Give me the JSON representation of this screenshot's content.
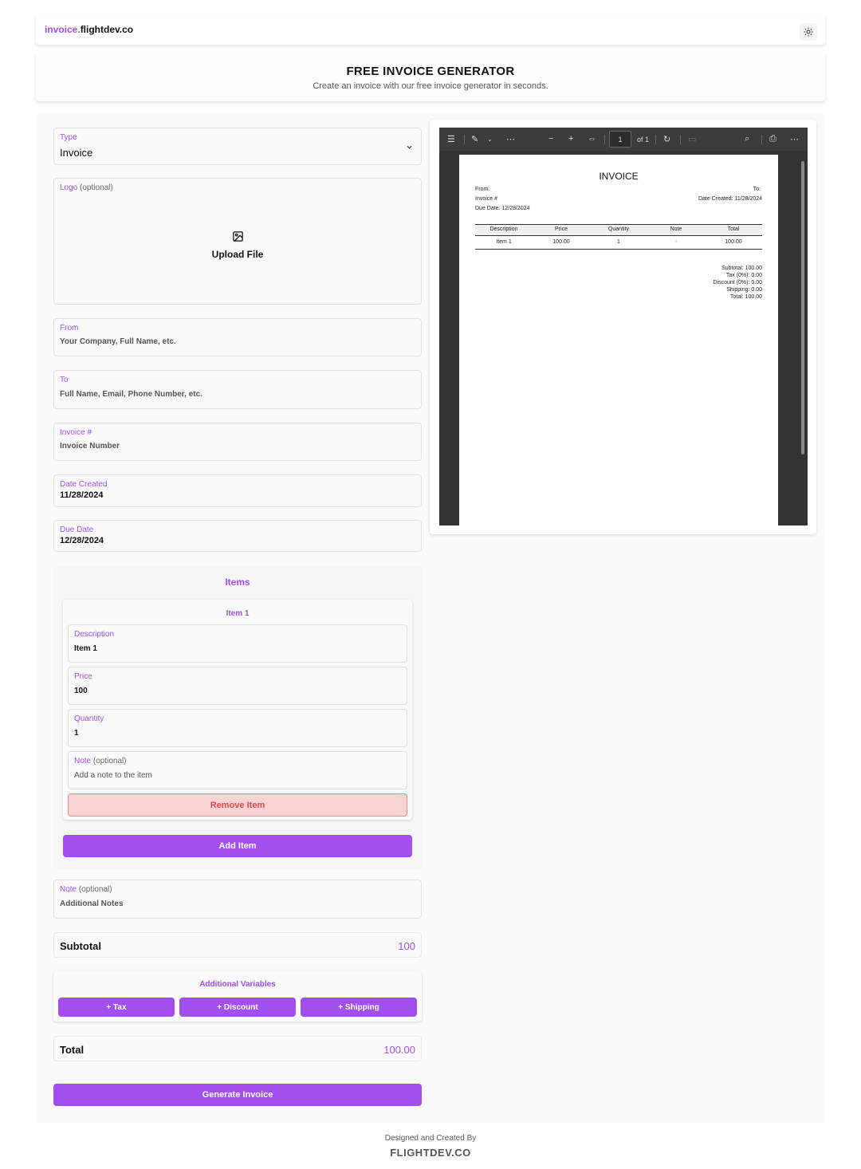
{
  "brand": {
    "part1": "invoice.",
    "part2": "flightdev.co"
  },
  "theme_toggle_icon": "sun-icon",
  "hero": {
    "title": "FREE INVOICE GENERATOR",
    "subtitle": "Create an invoice with our free invoice generator in seconds."
  },
  "form": {
    "type": {
      "label": "Type",
      "value": "Invoice"
    },
    "logo": {
      "label": "Logo",
      "optional": "(optional)",
      "upload": "Upload File"
    },
    "from": {
      "label": "From",
      "placeholder": "Your Company, Full Name, etc."
    },
    "to": {
      "label": "To",
      "placeholder": "Full Name, Email, Phone Number, etc."
    },
    "invoice_number": {
      "label": "Invoice #",
      "placeholder": "Invoice Number"
    },
    "date_created": {
      "label": "Date Created",
      "value": "11/28/2024"
    },
    "due_date": {
      "label": "Due Date",
      "value": "12/28/2024"
    }
  },
  "items": {
    "title": "Items",
    "list": [
      {
        "title": "Item 1",
        "description": {
          "label": "Description",
          "value": "Item 1"
        },
        "price": {
          "label": "Price",
          "value": "100"
        },
        "quantity": {
          "label": "Quantity",
          "value": "1"
        },
        "note": {
          "label": "Note",
          "optional": "(optional)",
          "placeholder": "Add a note to the item"
        },
        "remove_label": "Remove Item"
      }
    ],
    "add_label": "Add Item"
  },
  "note": {
    "label": "Note",
    "optional": "(optional)",
    "placeholder": "Additional Notes"
  },
  "subtotal": {
    "label": "Subtotal",
    "value": "100"
  },
  "additional": {
    "title": "Additional Variables",
    "tax": "+ Tax",
    "discount": "+ Discount",
    "shipping": "+ Shipping"
  },
  "total": {
    "label": "Total",
    "value": "100.00"
  },
  "generate_label": "Generate Invoice",
  "viewer": {
    "page_current": "1",
    "page_total": "of 1",
    "pdf": {
      "title": "INVOICE",
      "from": "From:",
      "to": "To:",
      "invoice_no": "Invoice #",
      "date_created": "Date Created: 11/28/2024",
      "due_date": "Due Date: 12/28/2024",
      "headers": [
        "Description",
        "Price",
        "Quantity",
        "Note",
        "Total"
      ],
      "row": [
        "Item 1",
        "100.00",
        "1",
        "-",
        "100.00"
      ],
      "subtotal": "Subtotal: 100.00",
      "tax": "Tax (0%): 0.00",
      "discount": "Discount (0%): 0.00",
      "shipping": "Shipping: 0.00",
      "total": "Total: 100.00"
    }
  },
  "footer": {
    "line1": "Designed and Created By",
    "line2": "FLIGHTDEV.CO"
  }
}
